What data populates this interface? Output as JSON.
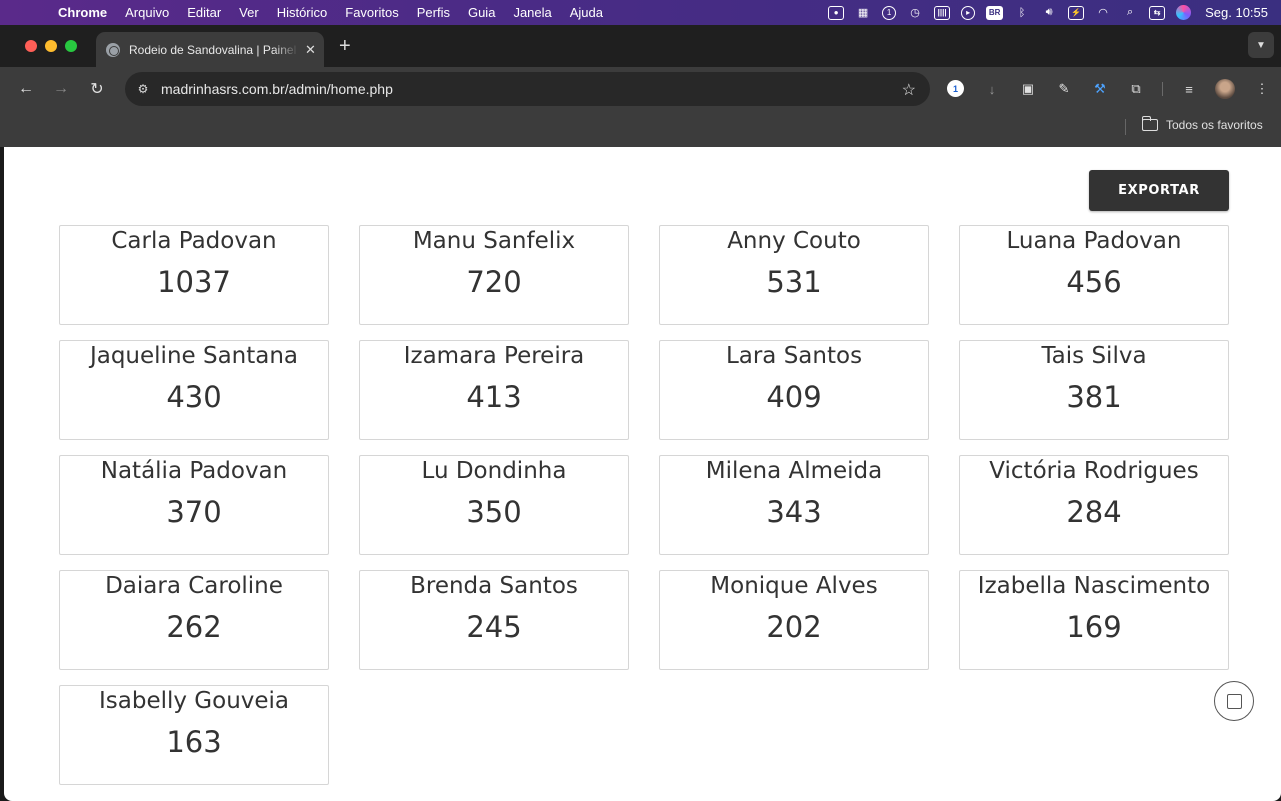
{
  "menubar": {
    "app": "Chrome",
    "items": [
      "Arquivo",
      "Editar",
      "Ver",
      "Histórico",
      "Favoritos",
      "Perfis",
      "Guia",
      "Janela",
      "Ajuda"
    ],
    "input_source": "BR",
    "clock": "Seg. 10:55"
  },
  "tab": {
    "title": "Rodeio de Sandovalina | Painel"
  },
  "toolbar": {
    "url": "madrinhasrs.com.br/admin/home.php"
  },
  "bookmarks": {
    "all_label": "Todos os favoritos"
  },
  "page": {
    "export_label": "EXPORTAR",
    "cards": [
      {
        "name": "Carla Padovan",
        "count": "1037"
      },
      {
        "name": "Manu Sanfelix",
        "count": "720"
      },
      {
        "name": "Anny Couto",
        "count": "531"
      },
      {
        "name": "Luana Padovan",
        "count": "456"
      },
      {
        "name": "Jaqueline Santana",
        "count": "430"
      },
      {
        "name": "Izamara Pereira",
        "count": "413"
      },
      {
        "name": "Lara Santos",
        "count": "409"
      },
      {
        "name": "Tais Silva",
        "count": "381"
      },
      {
        "name": "Natália Padovan",
        "count": "370"
      },
      {
        "name": "Lu Dondinha",
        "count": "350"
      },
      {
        "name": "Milena Almeida",
        "count": "343"
      },
      {
        "name": "Victória Rodrigues",
        "count": "284"
      },
      {
        "name": "Daiara Caroline",
        "count": "262"
      },
      {
        "name": "Brenda Santos",
        "count": "245"
      },
      {
        "name": "Monique Alves",
        "count": "202"
      },
      {
        "name": "Izabella Nascimento",
        "count": "169"
      },
      {
        "name": "Isabelly Gouveia",
        "count": "163"
      }
    ]
  },
  "colors": {
    "export_bg": "#333333",
    "card_border": "#d6d6d6",
    "text": "#333333"
  }
}
